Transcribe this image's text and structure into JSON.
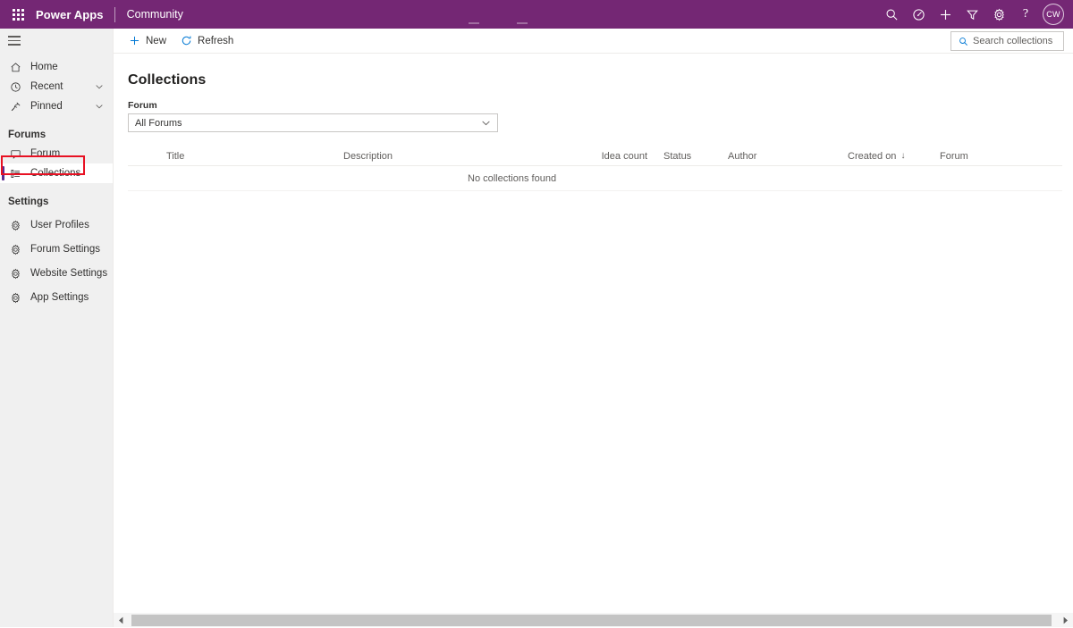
{
  "topbar": {
    "waffle_label": "app-launcher",
    "brand": "Power Apps",
    "app_name": "Community",
    "icons": [
      {
        "name": "search-icon",
        "label": "Search"
      },
      {
        "name": "environment-icon",
        "label": "Environment"
      },
      {
        "name": "plus-icon",
        "label": "Create"
      },
      {
        "name": "filter-icon",
        "label": "Filter"
      },
      {
        "name": "gear-icon",
        "label": "Settings"
      },
      {
        "name": "help-icon",
        "label": "?"
      }
    ],
    "avatar_initials": "CW",
    "brand_color": "#742774"
  },
  "sidebar": {
    "hamburger_label": "Site map",
    "items": [
      {
        "label": "Home",
        "icon": "home-icon",
        "expandable": false
      },
      {
        "label": "Recent",
        "icon": "clock-icon",
        "expandable": true
      },
      {
        "label": "Pinned",
        "icon": "pin-icon",
        "expandable": true
      }
    ],
    "groups": [
      {
        "title": "Forums",
        "items": [
          {
            "label": "Forum",
            "icon": "comment-icon",
            "selected": false
          },
          {
            "label": "Collections",
            "icon": "list-icon",
            "selected": true
          }
        ]
      },
      {
        "title": "Settings",
        "items": [
          {
            "label": "User Profiles",
            "icon": "gear-icon",
            "selected": false
          },
          {
            "label": "Forum Settings",
            "icon": "gear-icon",
            "selected": false
          },
          {
            "label": "Website Settings",
            "icon": "gear-icon",
            "selected": false
          },
          {
            "label": "App Settings",
            "icon": "gear-icon",
            "selected": false
          }
        ]
      }
    ],
    "selected_accent": "#5c2d91",
    "highlight_color": "#e81123"
  },
  "commandbar": {
    "new_label": "New",
    "refresh_label": "Refresh",
    "search_placeholder": "Search collections",
    "accent": "#0078d4"
  },
  "page": {
    "title": "Collections",
    "filter_label": "Forum",
    "filter_value": "All Forums"
  },
  "grid": {
    "columns": [
      {
        "key": "title",
        "label": "Title"
      },
      {
        "key": "description",
        "label": "Description"
      },
      {
        "key": "idea_count",
        "label": "Idea count"
      },
      {
        "key": "status",
        "label": "Status"
      },
      {
        "key": "author",
        "label": "Author"
      },
      {
        "key": "created_on",
        "label": "Created on",
        "sorted": "descending",
        "sort_glyph": "↓"
      },
      {
        "key": "forum",
        "label": "Forum"
      }
    ],
    "rows": [],
    "empty_text": "No collections found"
  },
  "scrollbar": {
    "left_arrow": "◀",
    "right_arrow": "▶"
  }
}
